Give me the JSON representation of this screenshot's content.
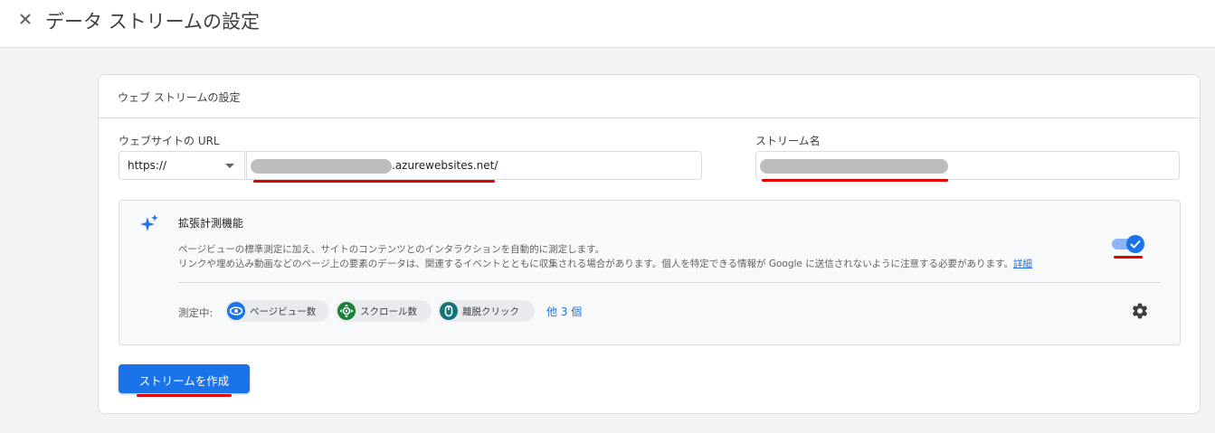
{
  "header": {
    "title": "データ ストリームの設定",
    "close_icon": "close-icon"
  },
  "card": {
    "title": "ウェブ ストリームの設定",
    "url_label": "ウェブサイトの URL",
    "protocol_value": "https://",
    "url_suffix": ".azurewebsites.net/",
    "stream_name_label": "ストリーム名"
  },
  "enhanced": {
    "title": "拡張計測機能",
    "desc_line1": "ページビューの標準測定に加え、サイトのコンテンツとのインタラクションを自動的に測定します。",
    "desc_line2": "リンクや埋め込み動画などのページ上の要素のデータは、関連するイベントとともに収集される場合があります。個人を特定できる情報が Google に送信されないように注意する必要があります。",
    "link_label": "詳細",
    "toggle_on": true,
    "measuring_label": "測定中:",
    "chips": [
      {
        "label": "ページビュー数",
        "icon": "eye-icon",
        "color": "#1a73e8"
      },
      {
        "label": "スクロール数",
        "icon": "crosshair-icon",
        "color": "#188038"
      },
      {
        "label": "離脱クリック",
        "icon": "mouse-icon",
        "color": "#12737a"
      }
    ],
    "more_label": "他 3 個"
  },
  "actions": {
    "create_label": "ストリームを作成"
  },
  "colors": {
    "accent": "#1a73e8",
    "highlight_underline": "#e00000"
  }
}
